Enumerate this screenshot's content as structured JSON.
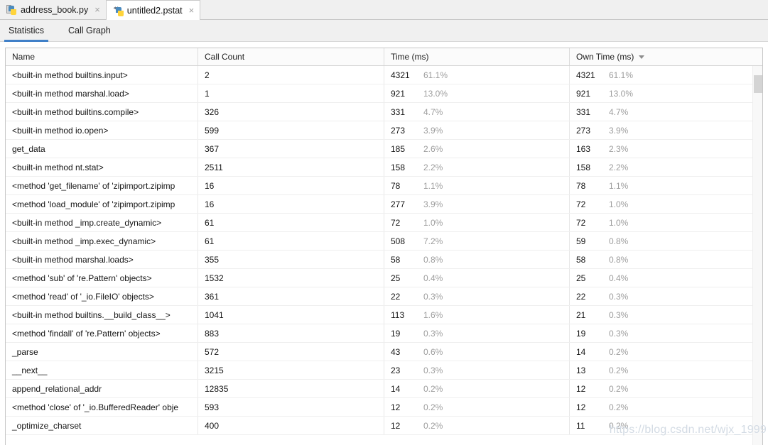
{
  "editor_tabs": [
    {
      "label": "address_book.py",
      "icon": "python-file-icon",
      "active": false,
      "close": "×"
    },
    {
      "label": "untitled2.pstat",
      "icon": "python-profile-icon",
      "active": true,
      "close": "×"
    }
  ],
  "sub_tabs": [
    {
      "label": "Statistics",
      "selected": true
    },
    {
      "label": "Call Graph",
      "selected": false
    }
  ],
  "table": {
    "columns": [
      {
        "label": "Name",
        "sorted": false
      },
      {
        "label": "Call Count",
        "sorted": false
      },
      {
        "label": "Time (ms)",
        "sorted": false
      },
      {
        "label": "Own Time (ms)",
        "sorted": true,
        "sort_dir": "desc"
      }
    ],
    "rows": [
      {
        "name": "<built-in method builtins.input>",
        "call_count": "2",
        "time": "4321",
        "time_pct": "61.1%",
        "own": "4321",
        "own_pct": "61.1%"
      },
      {
        "name": "<built-in method marshal.load>",
        "call_count": "1",
        "time": "921",
        "time_pct": "13.0%",
        "own": "921",
        "own_pct": "13.0%"
      },
      {
        "name": "<built-in method builtins.compile>",
        "call_count": "326",
        "time": "331",
        "time_pct": "4.7%",
        "own": "331",
        "own_pct": "4.7%"
      },
      {
        "name": "<built-in method io.open>",
        "call_count": "599",
        "time": "273",
        "time_pct": "3.9%",
        "own": "273",
        "own_pct": "3.9%"
      },
      {
        "name": "get_data",
        "call_count": "367",
        "time": "185",
        "time_pct": "2.6%",
        "own": "163",
        "own_pct": "2.3%"
      },
      {
        "name": "<built-in method nt.stat>",
        "call_count": "2511",
        "time": "158",
        "time_pct": "2.2%",
        "own": "158",
        "own_pct": "2.2%"
      },
      {
        "name": "<method 'get_filename' of 'zipimport.zipimp",
        "call_count": "16",
        "time": "78",
        "time_pct": "1.1%",
        "own": "78",
        "own_pct": "1.1%"
      },
      {
        "name": "<method 'load_module' of 'zipimport.zipimp",
        "call_count": "16",
        "time": "277",
        "time_pct": "3.9%",
        "own": "72",
        "own_pct": "1.0%"
      },
      {
        "name": "<built-in method _imp.create_dynamic>",
        "call_count": "61",
        "time": "72",
        "time_pct": "1.0%",
        "own": "72",
        "own_pct": "1.0%"
      },
      {
        "name": "<built-in method _imp.exec_dynamic>",
        "call_count": "61",
        "time": "508",
        "time_pct": "7.2%",
        "own": "59",
        "own_pct": "0.8%"
      },
      {
        "name": "<built-in method marshal.loads>",
        "call_count": "355",
        "time": "58",
        "time_pct": "0.8%",
        "own": "58",
        "own_pct": "0.8%"
      },
      {
        "name": "<method 'sub' of 're.Pattern' objects>",
        "call_count": "1532",
        "time": "25",
        "time_pct": "0.4%",
        "own": "25",
        "own_pct": "0.4%"
      },
      {
        "name": "<method 'read' of '_io.FileIO' objects>",
        "call_count": "361",
        "time": "22",
        "time_pct": "0.3%",
        "own": "22",
        "own_pct": "0.3%"
      },
      {
        "name": "<built-in method builtins.__build_class__>",
        "call_count": "1041",
        "time": "113",
        "time_pct": "1.6%",
        "own": "21",
        "own_pct": "0.3%"
      },
      {
        "name": "<method 'findall' of 're.Pattern' objects>",
        "call_count": "883",
        "time": "19",
        "time_pct": "0.3%",
        "own": "19",
        "own_pct": "0.3%"
      },
      {
        "name": "_parse",
        "call_count": "572",
        "time": "43",
        "time_pct": "0.6%",
        "own": "14",
        "own_pct": "0.2%"
      },
      {
        "name": "__next__",
        "call_count": "3215",
        "time": "23",
        "time_pct": "0.3%",
        "own": "13",
        "own_pct": "0.2%"
      },
      {
        "name": "append_relational_addr",
        "call_count": "12835",
        "time": "14",
        "time_pct": "0.2%",
        "own": "12",
        "own_pct": "0.2%"
      },
      {
        "name": "<method 'close' of '_io.BufferedReader' obje",
        "call_count": "593",
        "time": "12",
        "time_pct": "0.2%",
        "own": "12",
        "own_pct": "0.2%"
      },
      {
        "name": "_optimize_charset",
        "call_count": "400",
        "time": "12",
        "time_pct": "0.2%",
        "own": "11",
        "own_pct": "0.2%"
      }
    ]
  },
  "watermark": "https://blog.csdn.net/wjx_1999",
  "colors": {
    "accent": "#4080c8",
    "header_bg": "#fbfbfb",
    "chrome_bg": "#f0f0f0",
    "percent_text": "#9d9d9d",
    "watermark": "#d3dbe4"
  }
}
